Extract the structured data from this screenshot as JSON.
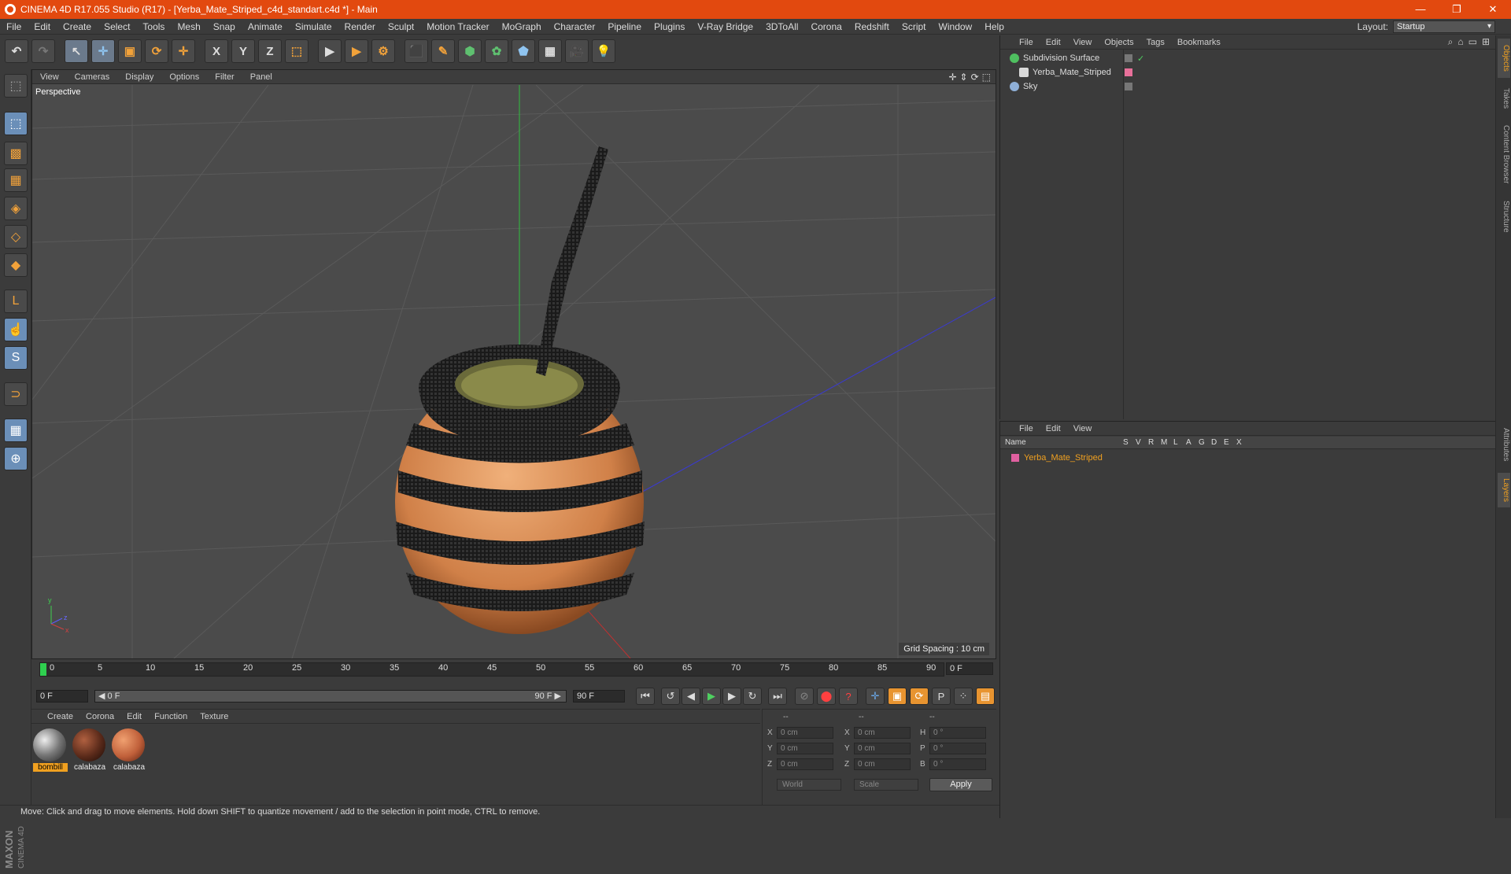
{
  "window": {
    "title": "CINEMA 4D R17.055 Studio (R17) - [Yerba_Mate_Striped_c4d_standart.c4d *] - Main",
    "min": "—",
    "max": "❐",
    "close": "✕"
  },
  "menu": [
    "File",
    "Edit",
    "Create",
    "Select",
    "Tools",
    "Mesh",
    "Snap",
    "Animate",
    "Simulate",
    "Render",
    "Sculpt",
    "Motion Tracker",
    "MoGraph",
    "Character",
    "Pipeline",
    "Plugins",
    "V-Ray Bridge",
    "3DToAll",
    "Corona",
    "Redshift",
    "Script",
    "Window",
    "Help"
  ],
  "layout": {
    "label": "Layout:",
    "value": "Startup"
  },
  "toolbar": {
    "undo": "↶",
    "redo": "↷",
    "select": "↖",
    "move": "✛",
    "scale": "▣",
    "rotate": "⟳",
    "multi": "✛",
    "x": "X",
    "y": "Y",
    "z": "Z",
    "coord": "⬚",
    "render_view": "▶",
    "render_pic": "▶",
    "render_settings": "⚙",
    "cube": "⬛",
    "pen": "✎",
    "subdiv": "⬢",
    "array": "✿",
    "deform": "⬟",
    "floor": "▦",
    "camera": "🎥",
    "light": "💡"
  },
  "lefttools": {
    "model": "⬚",
    "texture": "▩",
    "workplane": "▦",
    "points": "◈",
    "edges": "◇",
    "polys": "◆",
    "axis": "L",
    "tweak": "☝",
    "snap": "S",
    "magnet": "⊃",
    "grid_lock": "▦",
    "lock2": "⊕"
  },
  "viewport": {
    "menu": [
      "View",
      "Cameras",
      "Display",
      "Options",
      "Filter",
      "Panel"
    ],
    "icons": [
      "✛",
      "⇕",
      "⟳",
      "⬚"
    ],
    "label": "Perspective",
    "grid_spacing": "Grid Spacing : 10 cm",
    "axis": {
      "y": "y",
      "z": "z",
      "x": "x"
    }
  },
  "timeline": {
    "ticks": [
      "0",
      "5",
      "10",
      "15",
      "20",
      "25",
      "30",
      "35",
      "40",
      "45",
      "50",
      "55",
      "60",
      "65",
      "70",
      "75",
      "80",
      "85",
      "90"
    ],
    "current_frame": "0 F",
    "start": "0 F",
    "range_start": "◀ 0 F",
    "range_end": "90 F ▶",
    "end": "90 F"
  },
  "playback": {
    "first": "⏮",
    "prev_key": "↺",
    "prev": "◀",
    "play": "▶",
    "next": "▶",
    "next_key": "↻",
    "last": "⏭",
    "rec1": "⊘",
    "rec2": "⬤",
    "rec3": "?",
    "k1": "✛",
    "k2": "▣",
    "k3": "⟳",
    "k4": "P",
    "k5": "⁘",
    "k6": "▤"
  },
  "materials": {
    "menu": [
      "Create",
      "Corona",
      "Edit",
      "Function",
      "Texture"
    ],
    "items": [
      {
        "label": "bombill",
        "color": "#8a8a8a",
        "selected": true
      },
      {
        "label": "calabaza",
        "color": "#5a2a1a",
        "selected": false
      },
      {
        "label": "calabaza",
        "color": "#c0603a",
        "selected": false
      }
    ]
  },
  "coords": {
    "headers": [
      "--",
      "--",
      "--"
    ],
    "rows": [
      {
        "a": "X",
        "av": "0 cm",
        "b": "X",
        "bv": "0 cm",
        "c": "H",
        "cv": "0 °"
      },
      {
        "a": "Y",
        "av": "0 cm",
        "b": "Y",
        "bv": "0 cm",
        "c": "P",
        "cv": "0 °"
      },
      {
        "a": "Z",
        "av": "0 cm",
        "b": "Z",
        "bv": "0 cm",
        "c": "B",
        "cv": "0 °"
      }
    ],
    "mode": "World",
    "type": "Scale",
    "apply": "Apply"
  },
  "status": "Move: Click and drag to move elements. Hold down SHIFT to quantize movement / add to the selection in point mode, CTRL to remove.",
  "objects": {
    "menu": [
      "File",
      "Edit",
      "View",
      "Objects",
      "Tags",
      "Bookmarks"
    ],
    "icons": [
      "⌕",
      "⌂",
      "▭",
      "⊞"
    ],
    "items": [
      {
        "name": "Subdivision Surface",
        "icon_color": "#4fc060",
        "check": "✓"
      },
      {
        "name": "Yerba_Mate_Striped",
        "icon_color": "#d9d9d9",
        "check": ""
      },
      {
        "name": "Sky",
        "icon_color": "#8fb0d8",
        "check": ""
      }
    ]
  },
  "layers": {
    "menu": [
      "File",
      "Edit",
      "View"
    ],
    "header": {
      "name": "Name",
      "cols": [
        "S",
        "V",
        "R",
        "M",
        "L",
        "A",
        "G",
        "D",
        "E",
        "X"
      ]
    },
    "items": [
      {
        "name": "Yerba_Mate_Striped",
        "color": "#e060a0"
      }
    ]
  },
  "sidetabs": [
    "Objects",
    "Takes",
    "Content Browser",
    "Structure",
    "Attributes",
    "Layers"
  ],
  "maxon": {
    "brand": "MAXON",
    "product": "CINEMA 4D"
  }
}
